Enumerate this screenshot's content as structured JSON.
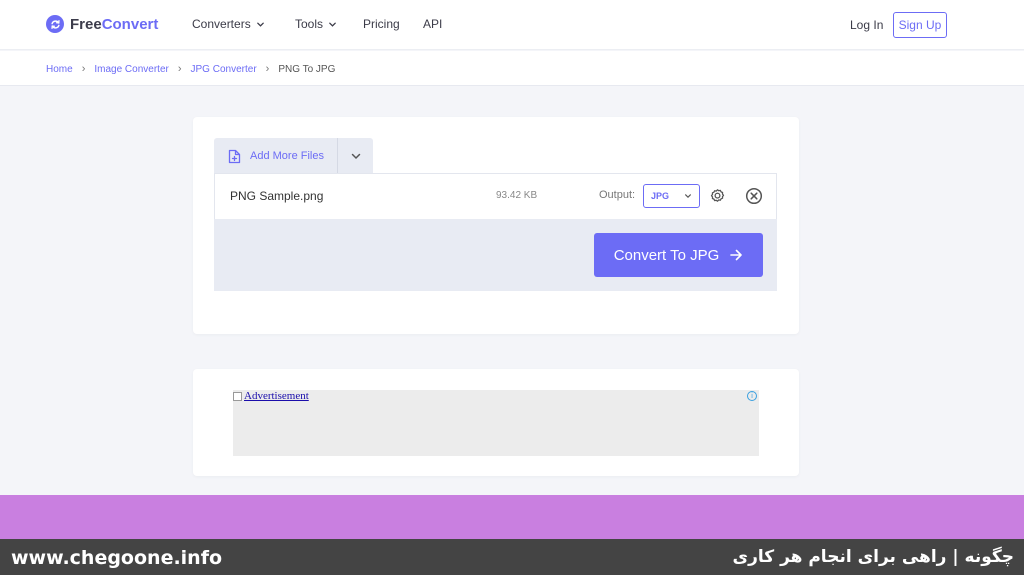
{
  "header": {
    "logo_brand": "Free",
    "logo_accent": "Convert",
    "nav": [
      {
        "label": "Converters",
        "has_dropdown": true
      },
      {
        "label": "Tools",
        "has_dropdown": true
      },
      {
        "label": "Pricing",
        "has_dropdown": false
      },
      {
        "label": "API",
        "has_dropdown": false
      }
    ],
    "login_label": "Log In",
    "signup_label": "Sign Up"
  },
  "breadcrumb": {
    "items": [
      "Home",
      "Image Converter",
      "JPG Converter"
    ],
    "current": "PNG To JPG"
  },
  "uploader": {
    "add_more_label": "Add More Files",
    "file": {
      "name": "PNG Sample.png",
      "size": "93.42 KB",
      "output_label": "Output:",
      "output_value": "JPG"
    },
    "convert_label": "Convert To JPG"
  },
  "ad": {
    "link_text": "Advertisement",
    "info_glyph": "i"
  },
  "watermark": {
    "left_text": "www.chegoone.info",
    "right_text": "چگونه | راهی برای انجام هر کاری"
  },
  "colors": {
    "accent": "#6c6cf5",
    "band": "#c97fe0",
    "footer": "#444444"
  }
}
